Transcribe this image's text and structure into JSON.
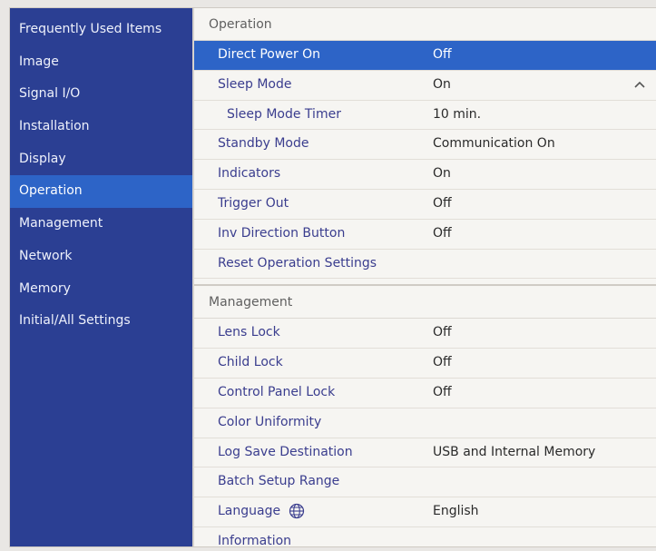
{
  "sidebar": {
    "items": [
      {
        "label": "Frequently Used Items"
      },
      {
        "label": "Image"
      },
      {
        "label": "Signal I/O"
      },
      {
        "label": "Installation"
      },
      {
        "label": "Display"
      },
      {
        "label": "Operation",
        "active": true
      },
      {
        "label": "Management"
      },
      {
        "label": "Network"
      },
      {
        "label": "Memory"
      },
      {
        "label": "Initial/All Settings"
      }
    ]
  },
  "operation": {
    "header": "Operation",
    "rows": [
      {
        "label": "Direct Power On",
        "value": "Off",
        "selected": true
      },
      {
        "label": "Sleep Mode",
        "value": "On"
      },
      {
        "label": "Sleep Mode Timer",
        "value": "10 min.",
        "indent": true
      },
      {
        "label": "Standby Mode",
        "value": "Communication On"
      },
      {
        "label": "Indicators",
        "value": "On"
      },
      {
        "label": "Trigger Out",
        "value": "Off"
      },
      {
        "label": "Inv Direction Button",
        "value": "Off"
      },
      {
        "label": "Reset Operation Settings",
        "value": ""
      }
    ]
  },
  "management": {
    "header": "Management",
    "rows": [
      {
        "label": "Lens Lock",
        "value": "Off"
      },
      {
        "label": "Child Lock",
        "value": "Off"
      },
      {
        "label": "Control Panel Lock",
        "value": "Off"
      },
      {
        "label": "Color Uniformity",
        "value": ""
      },
      {
        "label": "Log Save Destination",
        "value": "USB and Internal Memory"
      },
      {
        "label": "Batch Setup Range",
        "value": ""
      },
      {
        "label": "Language",
        "value": "English",
        "icon": "globe-icon"
      },
      {
        "label": "Information",
        "value": ""
      }
    ]
  },
  "colors": {
    "sidebar_bg": "#2b3f93",
    "selection": "#2d64c7",
    "panel_bg": "#f6f5f2",
    "label_text": "#3a3d8e"
  }
}
